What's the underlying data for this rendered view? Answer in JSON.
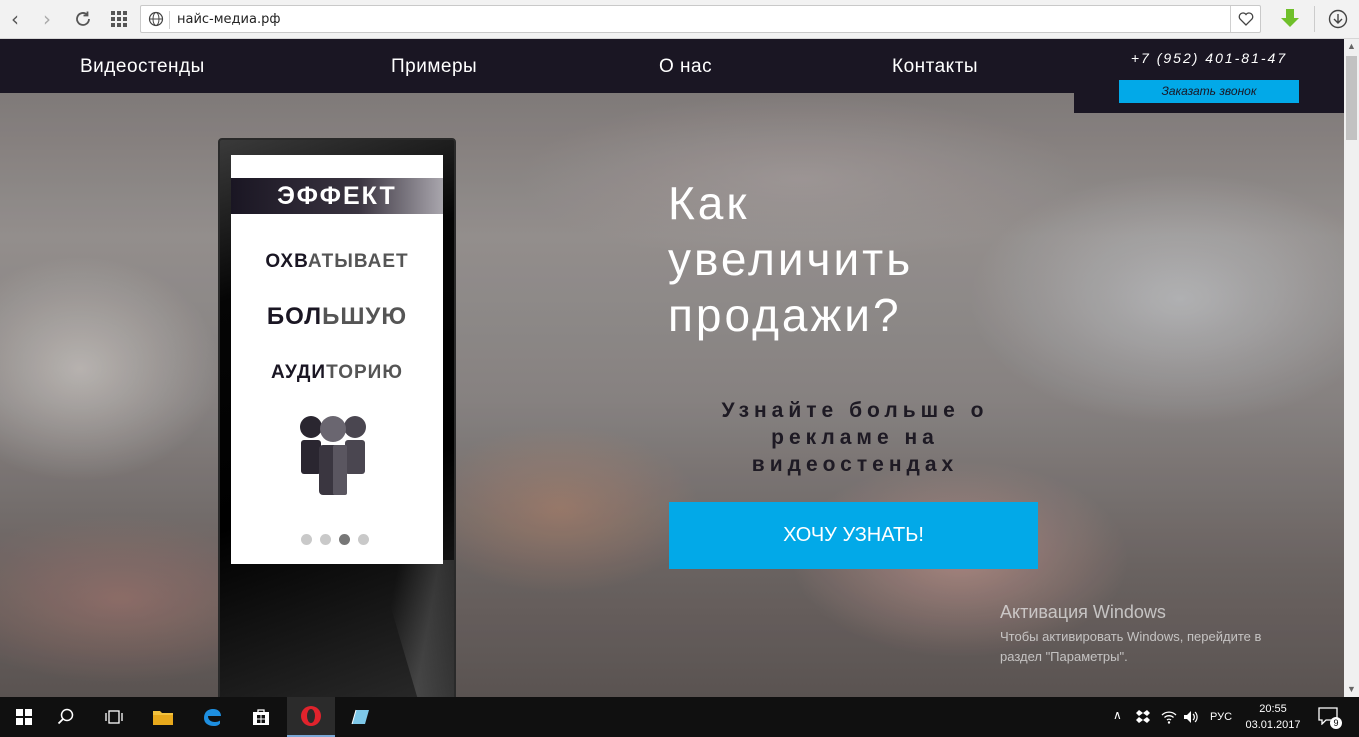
{
  "browser": {
    "url": "найс-медиа.рф"
  },
  "site_nav": {
    "items": [
      {
        "label": "Видеостенды"
      },
      {
        "label": "Примеры"
      },
      {
        "label": "О нас"
      },
      {
        "label": "Контакты"
      }
    ],
    "phone": "+7 (952) 401-81-47",
    "callback_label": "Заказать звонок"
  },
  "kiosk": {
    "header": "ЭФФЕКТ",
    "lines": [
      {
        "bold": "ОХВ",
        "light": "АТЫВАЕТ"
      },
      {
        "bold": "БОЛ",
        "light": "ЬШУЮ"
      },
      {
        "bold": "АУДИ",
        "light": "ТОРИЮ"
      }
    ],
    "active_slide": 3,
    "slide_count": 4
  },
  "hero": {
    "title_lines": [
      "Как",
      "увеличить",
      "продажи?"
    ],
    "subtitle_lines": [
      "Узнайте больше о",
      "рекламе на",
      "видеостендах"
    ],
    "cta_label": "ХОЧУ УЗНАТЬ!"
  },
  "watermark": {
    "title": "Активация Windows",
    "line1": "Чтобы активировать Windows, перейдите в",
    "line2": "раздел \"Параметры\"."
  },
  "taskbar": {
    "language": "РУС",
    "time": "20:55",
    "date": "03.01.2017",
    "notifications": "9"
  },
  "colors": {
    "accent": "#02a9e8",
    "nav_bg": "#1a1623"
  }
}
